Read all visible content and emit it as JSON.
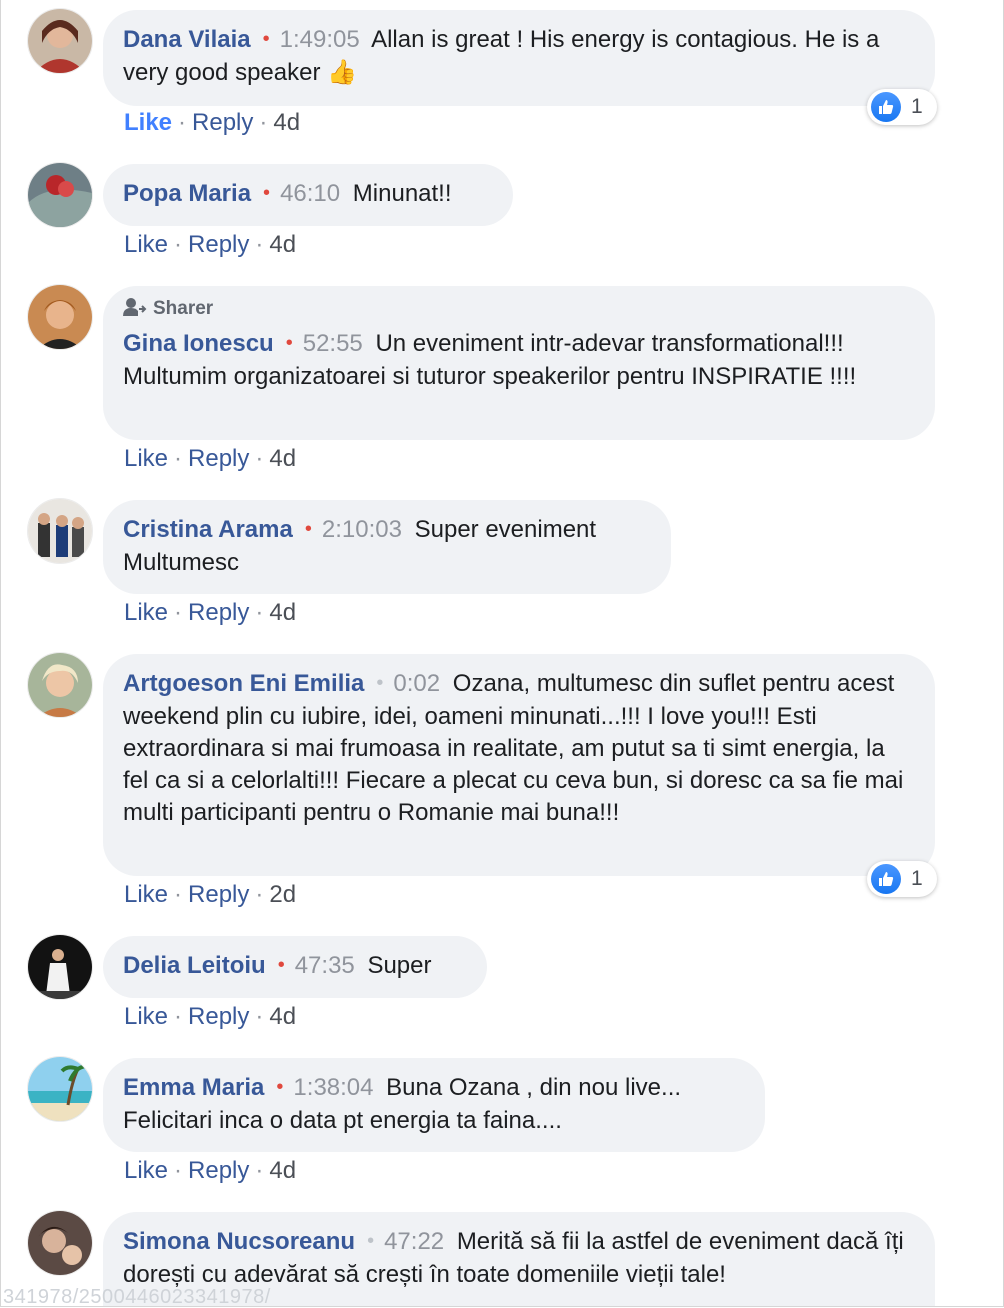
{
  "comments": [
    {
      "name": "Dana Vilaia",
      "timestamp": "1:49:05",
      "text": "Allan is great ! His energy is contagious. He is a very good speaker 👍",
      "like_label": "Like",
      "reply_label": "Reply",
      "age": "4d",
      "reactions": "1"
    },
    {
      "name": "Popa Maria",
      "timestamp": "46:10",
      "text": "Minunat!!",
      "like_label": "Like",
      "reply_label": "Reply",
      "age": "4d"
    },
    {
      "badge": "Sharer",
      "name": "Gina Ionescu",
      "timestamp": "52:55",
      "text": "Un eveniment intr-adevar transformational!!! Multumim organizatoarei si tuturor speakerilor pentru INSPIRATIE !!!!",
      "like_label": "Like",
      "reply_label": "Reply",
      "age": "4d"
    },
    {
      "name": "Cristina Arama",
      "timestamp": "2:10:03",
      "text": "Super eveniment Multumesc",
      "like_label": "Like",
      "reply_label": "Reply",
      "age": "4d"
    },
    {
      "name": "Artgoeson Eni Emilia",
      "timestamp": "0:02",
      "text": "Ozana, multumesc din suflet pentru acest weekend plin cu iubire, idei, oameni minunati...!!! I love you!!! Esti extraordinara si mai frumoasa in realitate, am putut sa ti simt energia, la fel ca si a celorlalti!!! Fiecare a plecat cu ceva bun, si doresc ca sa fie mai multi participanti pentru o Romanie mai buna!!!",
      "like_label": "Like",
      "reply_label": "Reply",
      "age": "2d",
      "reactions": "1"
    },
    {
      "name": "Delia Leitoiu",
      "timestamp": "47:35",
      "text": "Super",
      "like_label": "Like",
      "reply_label": "Reply",
      "age": "4d"
    },
    {
      "name": "Emma Maria",
      "timestamp": "1:38:04",
      "text": "Buna Ozana , din nou live... Felicitari inca o data pt energia ta faina....",
      "like_label": "Like",
      "reply_label": "Reply",
      "age": "4d"
    },
    {
      "name": "Simona Nucsoreanu",
      "timestamp": "47:22",
      "text": "Merită să fii la astfel de eveniment dacă îți dorești cu adevărat să crești în toate domeniile vieții tale!"
    }
  ],
  "watermark": "341978/2500446023341978/",
  "colors": {
    "name": "#385898",
    "bubble": "#f0f2f5",
    "timestamp": "#90949c",
    "live_dot": "#e0483d",
    "like_active": "#4080ff"
  }
}
